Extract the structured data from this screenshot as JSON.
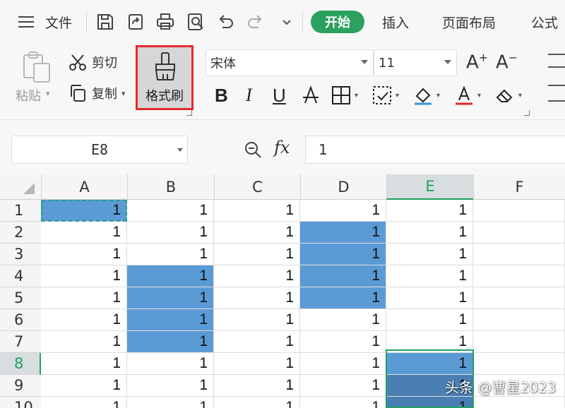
{
  "menubar": {
    "file_label": "文件",
    "tabs": {
      "start": "开始",
      "insert": "插入",
      "page_layout": "页面布局",
      "formula": "公式"
    }
  },
  "ribbon": {
    "paste_label": "粘贴",
    "cut_label": "剪切",
    "copy_label": "复制",
    "format_painter_label": "格式刷",
    "font_name": "宋体",
    "font_size": "11",
    "bold": "B",
    "italic": "I",
    "underline": "U"
  },
  "formula_bar": {
    "name_box": "E8",
    "fx": "fx",
    "value": "1"
  },
  "grid": {
    "columns": [
      "A",
      "B",
      "C",
      "D",
      "E",
      "F"
    ],
    "rows": [
      "1",
      "2",
      "3",
      "4",
      "5",
      "6",
      "7",
      "8",
      "9",
      "10"
    ],
    "cell_value": "1",
    "active_cell": "E8",
    "copy_source": "A1",
    "filled_cells": [
      "A1",
      "B4",
      "B5",
      "B6",
      "B7",
      "D2",
      "D3",
      "D4",
      "D5",
      "E8",
      "E9",
      "E10"
    ]
  },
  "colors": {
    "accent_green": "#2aa15f",
    "cell_fill": "#5b9bd5",
    "highlight_red": "#e22b2b"
  },
  "watermark": "头条 @曹星2023"
}
